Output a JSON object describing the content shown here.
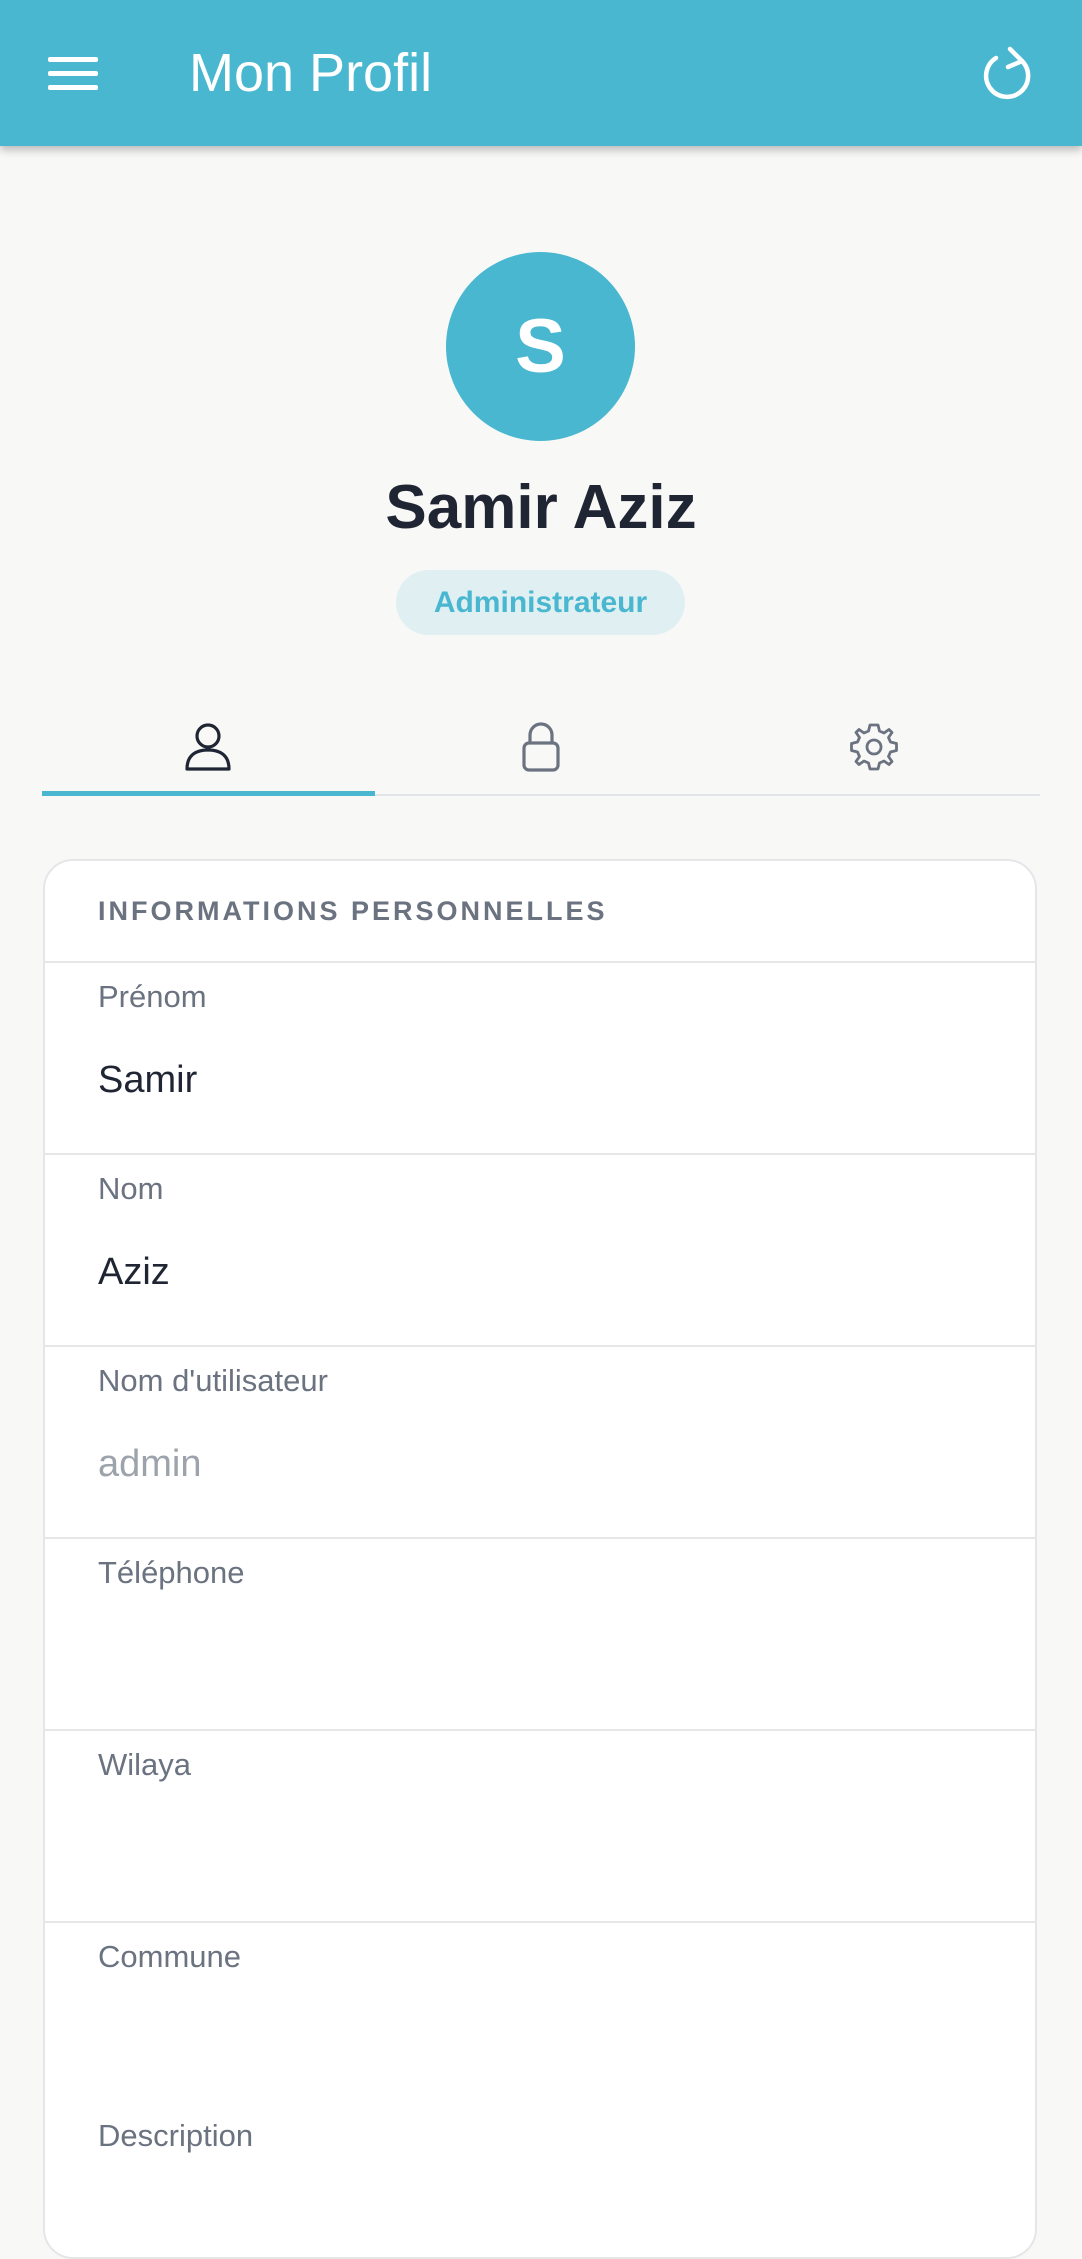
{
  "header": {
    "title": "Mon Profil",
    "menu_icon": "hamburger-menu-icon",
    "refresh_icon": "refresh-icon",
    "color": "#48b7cf"
  },
  "profile": {
    "avatar_letter": "S",
    "name": "Samir Aziz",
    "role": "Administrateur"
  },
  "tabs": [
    {
      "icon": "user-icon",
      "active": true
    },
    {
      "icon": "lock-icon",
      "active": false
    },
    {
      "icon": "gear-icon",
      "active": false
    }
  ],
  "card": {
    "title": "INFORMATIONS PERSONNELLES",
    "fields": [
      {
        "label": "Prénom",
        "value": "Samir"
      },
      {
        "label": "Nom",
        "value": "Aziz"
      },
      {
        "label": "Nom d'utilisateur",
        "value": "admin"
      },
      {
        "label": "Téléphone",
        "value": ""
      },
      {
        "label": "Wilaya",
        "value": ""
      },
      {
        "label": "Commune",
        "value": ""
      },
      {
        "label": "Description",
        "value": ""
      }
    ]
  }
}
